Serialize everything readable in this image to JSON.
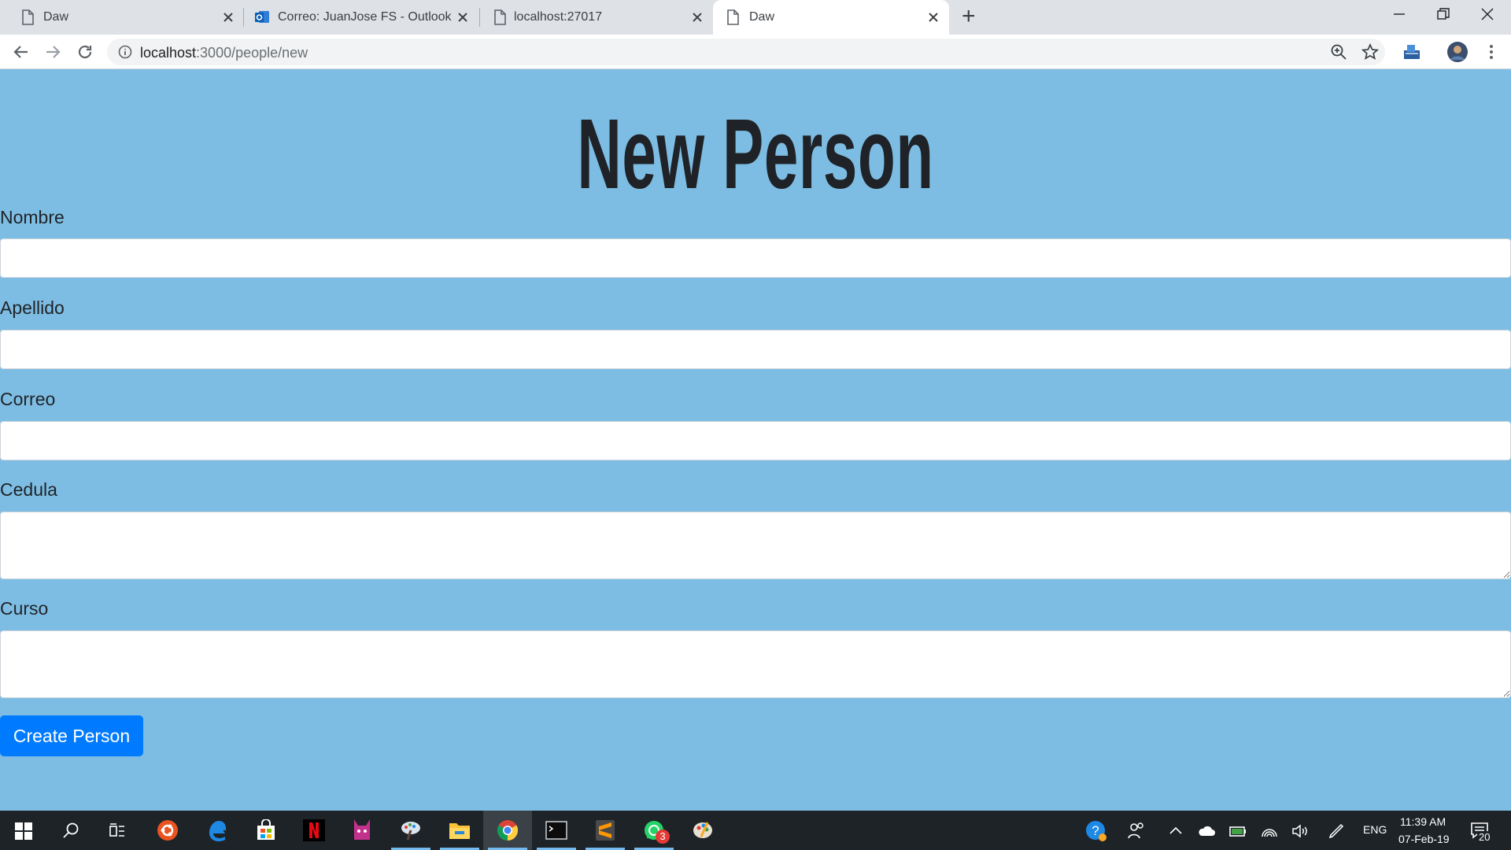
{
  "browser": {
    "tabs": [
      {
        "title": "Daw",
        "icon": "page-icon",
        "active": false
      },
      {
        "title": "Correo: JuanJose FS - Outlook",
        "icon": "outlook-icon",
        "active": false
      },
      {
        "title": "localhost:27017",
        "icon": "page-icon",
        "active": false
      },
      {
        "title": "Daw",
        "icon": "page-icon",
        "active": true
      }
    ],
    "new_tab_label": "+",
    "url_host": "localhost",
    "url_path": ":3000/people/new",
    "colors": {
      "tabstrip": "#dee1e6",
      "omnibox": "#f1f3f4"
    }
  },
  "page": {
    "title": "New Person",
    "fields": [
      {
        "label": "Nombre",
        "value": "",
        "type": "input"
      },
      {
        "label": "Apellido",
        "value": "",
        "type": "input"
      },
      {
        "label": "Correo",
        "value": "",
        "type": "input"
      },
      {
        "label": "Cedula",
        "value": "",
        "type": "textarea"
      },
      {
        "label": "Curso",
        "value": "",
        "type": "textarea"
      }
    ],
    "submit_label": "Create Person",
    "colors": {
      "background": "#7ebde3",
      "button": "#007bff"
    }
  },
  "taskbar": {
    "apps": [
      "ubuntu-icon",
      "edge-icon",
      "store-icon",
      "netflix-icon",
      "purple-app-icon",
      "paint-icon",
      "file-explorer-icon",
      "chrome-icon",
      "terminal-icon",
      "sublime-icon",
      "whatsapp-icon",
      "paint3d-icon"
    ],
    "whatsapp_badge": "3",
    "language": "ENG",
    "time": "11:39 AM",
    "date": "07-Feb-19",
    "notifications": "20"
  }
}
